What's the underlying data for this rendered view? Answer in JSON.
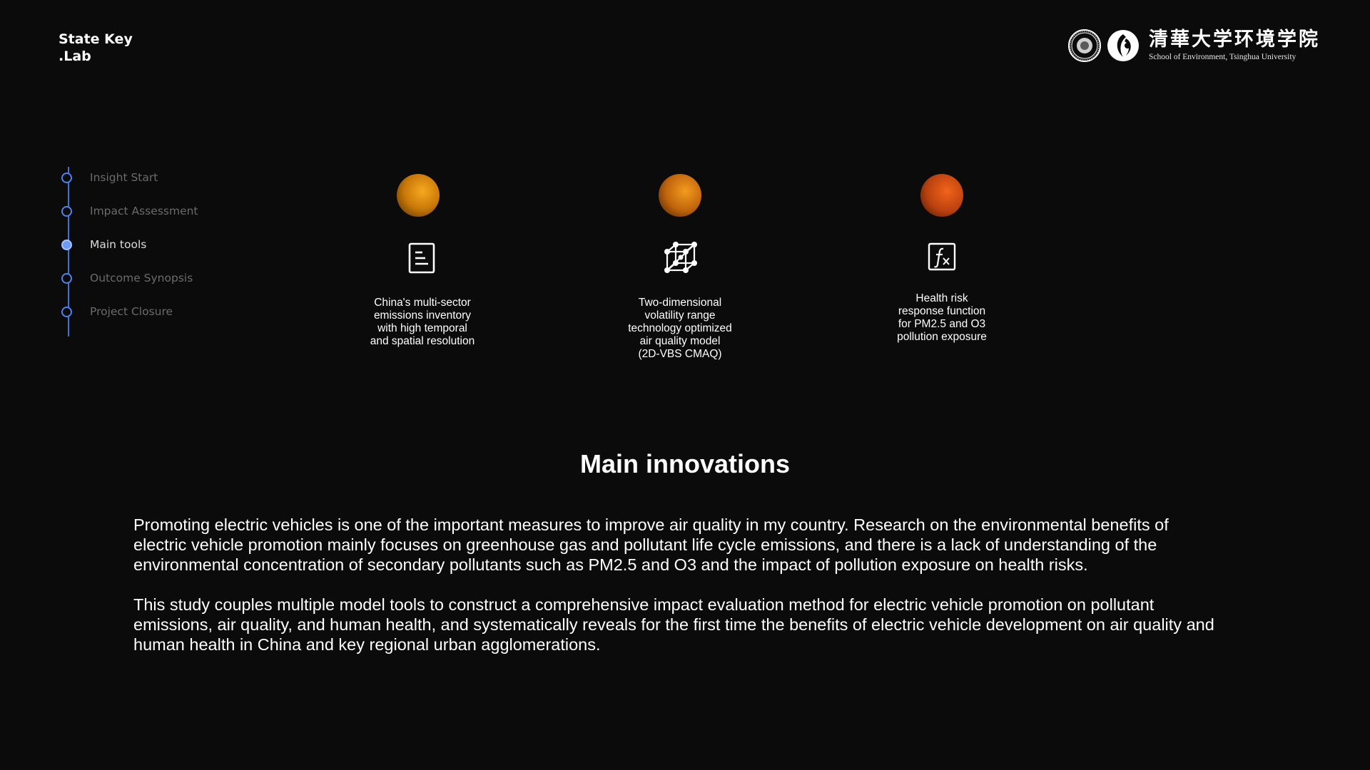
{
  "brand": {
    "line1": "State Key",
    "line2": ".Lab"
  },
  "logo": {
    "name_cn": "清華大学环境学院",
    "name_en": "School of Environment, Tsinghua University"
  },
  "timeline": {
    "items": [
      {
        "label": "Insight Start",
        "active": false
      },
      {
        "label": "Impact Assessment",
        "active": false
      },
      {
        "label": "Main tools",
        "active": true
      },
      {
        "label": "Outcome Synopsis",
        "active": false
      },
      {
        "label": "Project Closure",
        "active": false
      }
    ]
  },
  "tools": [
    {
      "icon": "document-icon",
      "text": "China's multi-sector\nemissions inventory\nwith high temporal\nand spatial resolution",
      "orb_color": "#f6a920"
    },
    {
      "icon": "network-cube-icon",
      "text": "Two-dimensional\nvolatility range\ntechnology optimized\nair quality model\n(2D-VBS CMAQ)",
      "orb_color": "#f49a1e"
    },
    {
      "icon": "function-icon",
      "text": "Health risk\nresponse function\nfor PM2.5 and O3\npollution exposure",
      "orb_color": "#f2631a"
    }
  ],
  "section": {
    "title": "Main innovations",
    "paragraphs": [
      "Promoting electric vehicles is one of the important measures to improve air quality in my country. Research on the environmental benefits of electric vehicle promotion mainly focuses on greenhouse gas and pollutant life cycle emissions, and there is a lack of understanding of the environmental concentration of secondary pollutants such as PM2.5 and O3 and the impact of pollution exposure on health risks.",
      "This study couples multiple model tools to construct a comprehensive impact evaluation method for electric vehicle promotion on pollutant emissions, air quality, and human health, and systematically reveals for the first time the benefits of electric vehicle development on air quality and human health in China and key regional urban agglomerations."
    ]
  },
  "colors": {
    "background": "#0b0b0c",
    "timeline_accent": "#4f82f0"
  }
}
